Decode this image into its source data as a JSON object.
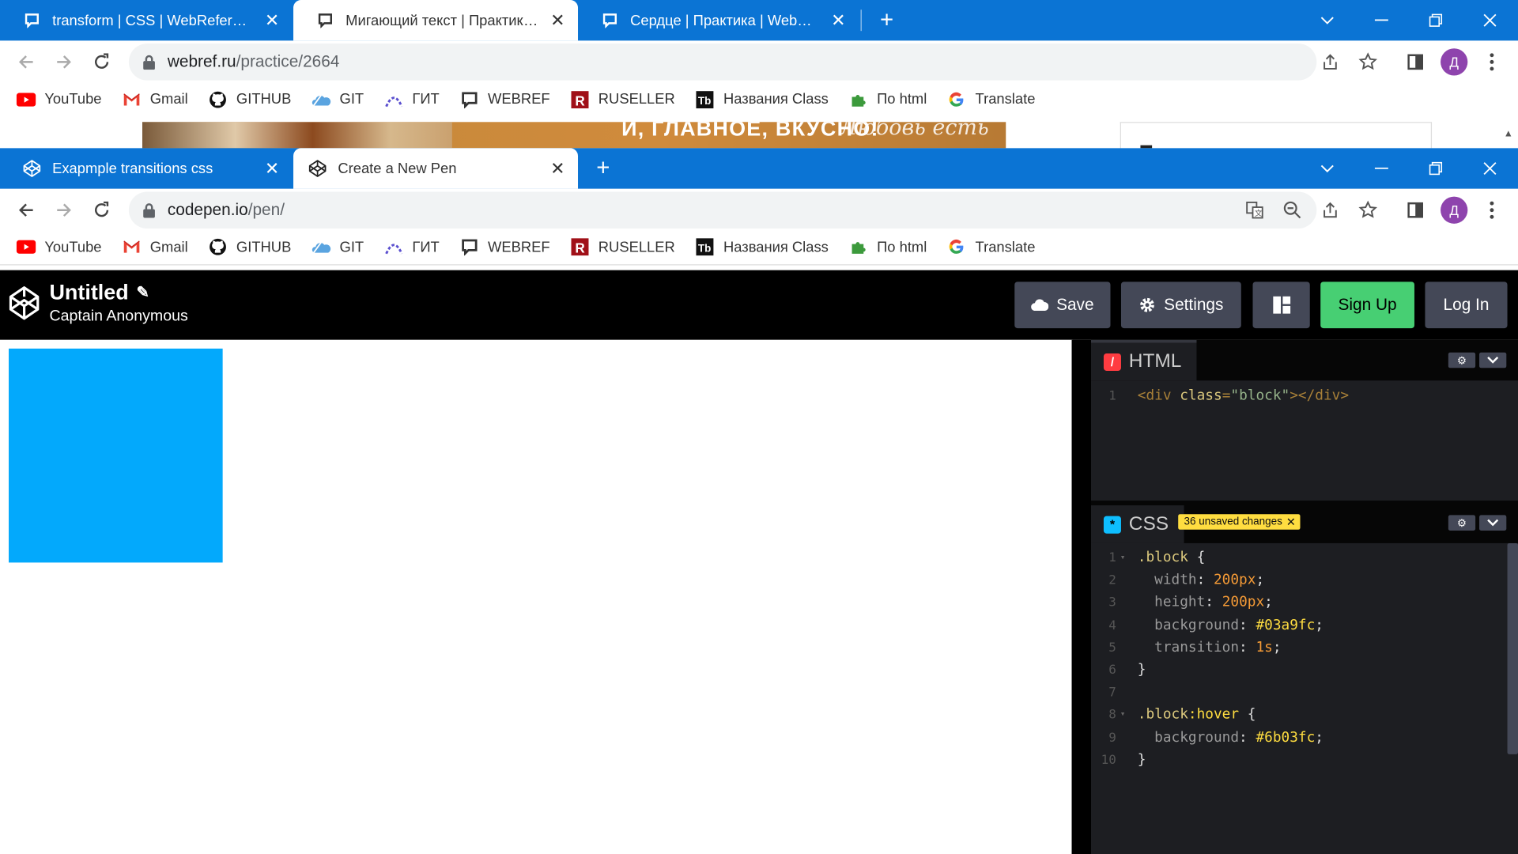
{
  "back_window": {
    "tabs": [
      {
        "title": "transform | CSS | WebReference",
        "active": false
      },
      {
        "title": "Мигающий текст | Практика | WebReference",
        "active": true
      },
      {
        "title": "Сердце | Практика | WebReference",
        "active": false
      }
    ],
    "url_domain": "webref.ru",
    "url_path": "/practice/2664",
    "ad": {
      "text": "И, ГЛАВНОЕ, ВКУСНО!",
      "script_text": "Любовь есть"
    }
  },
  "front_window": {
    "tabs": [
      {
        "title": "Exapmple transitions css",
        "active": false
      },
      {
        "title": "Create a New Pen",
        "active": true
      }
    ],
    "url_domain": "codepen.io",
    "url_path": "/pen/"
  },
  "bookmarks": [
    {
      "label": "YouTube",
      "icon": "youtube-icon"
    },
    {
      "label": "Gmail",
      "icon": "gmail-icon"
    },
    {
      "label": "GITHUB",
      "icon": "github-icon"
    },
    {
      "label": "GIT",
      "icon": "git-cloud-icon"
    },
    {
      "label": "ГИТ",
      "icon": "git-arc-icon"
    },
    {
      "label": "WEBREF",
      "icon": "webref-icon"
    },
    {
      "label": "RUSELLER",
      "icon": "ruseller-icon"
    },
    {
      "label": "Названия Class",
      "icon": "tb-icon"
    },
    {
      "label": "По html",
      "icon": "puzzle-icon"
    },
    {
      "label": "Translate",
      "icon": "google-icon"
    }
  ],
  "profile_initial": "Д",
  "codepen": {
    "title": "Untitled",
    "author": "Captain Anonymous",
    "buttons": {
      "save": "Save",
      "settings": "Settings",
      "signup": "Sign Up",
      "login": "Log In"
    },
    "html_panel": {
      "label": "HTML",
      "lines": [
        {
          "n": "1",
          "parts": [
            [
              "tag",
              "<div "
            ],
            [
              "attr",
              "class"
            ],
            [
              "tag",
              "="
            ],
            [
              "str",
              "\"block\""
            ],
            [
              "tag",
              "></div>"
            ]
          ]
        }
      ]
    },
    "css_panel": {
      "label": "CSS",
      "badge": "36 unsaved changes",
      "lines": [
        {
          "n": "1",
          "fold": true,
          "parts": [
            [
              "sel",
              ".block"
            ],
            [
              "brace",
              " {"
            ]
          ]
        },
        {
          "n": "2",
          "parts": [
            [
              "prop",
              "  width"
            ],
            [
              "brace",
              ": "
            ],
            [
              "num",
              "200px"
            ],
            [
              "brace",
              ";"
            ]
          ]
        },
        {
          "n": "3",
          "parts": [
            [
              "prop",
              "  height"
            ],
            [
              "brace",
              ": "
            ],
            [
              "num",
              "200px"
            ],
            [
              "brace",
              ";"
            ]
          ]
        },
        {
          "n": "4",
          "parts": [
            [
              "prop",
              "  background"
            ],
            [
              "brace",
              ": "
            ],
            [
              "val",
              "#03a9fc"
            ],
            [
              "brace",
              ";"
            ]
          ]
        },
        {
          "n": "5",
          "parts": [
            [
              "prop",
              "  transition"
            ],
            [
              "brace",
              ": "
            ],
            [
              "num",
              "1s"
            ],
            [
              "brace",
              ";"
            ]
          ]
        },
        {
          "n": "6",
          "parts": [
            [
              "brace",
              "}"
            ]
          ]
        },
        {
          "n": "7",
          "parts": []
        },
        {
          "n": "8",
          "fold": true,
          "parts": [
            [
              "sel",
              ".block"
            ],
            [
              "pseudo",
              ":hover"
            ],
            [
              "brace",
              " {"
            ]
          ]
        },
        {
          "n": "9",
          "parts": [
            [
              "prop",
              "  background"
            ],
            [
              "brace",
              ": "
            ],
            [
              "val",
              "#6b03fc"
            ],
            [
              "brace",
              ";"
            ]
          ]
        },
        {
          "n": "10",
          "parts": [
            [
              "brace",
              "}"
            ]
          ]
        }
      ]
    },
    "preview_block_color": "#03a9fc"
  },
  "colors": {
    "chrome_blue": "#0b74d4",
    "codepen_green": "#47cf73"
  }
}
